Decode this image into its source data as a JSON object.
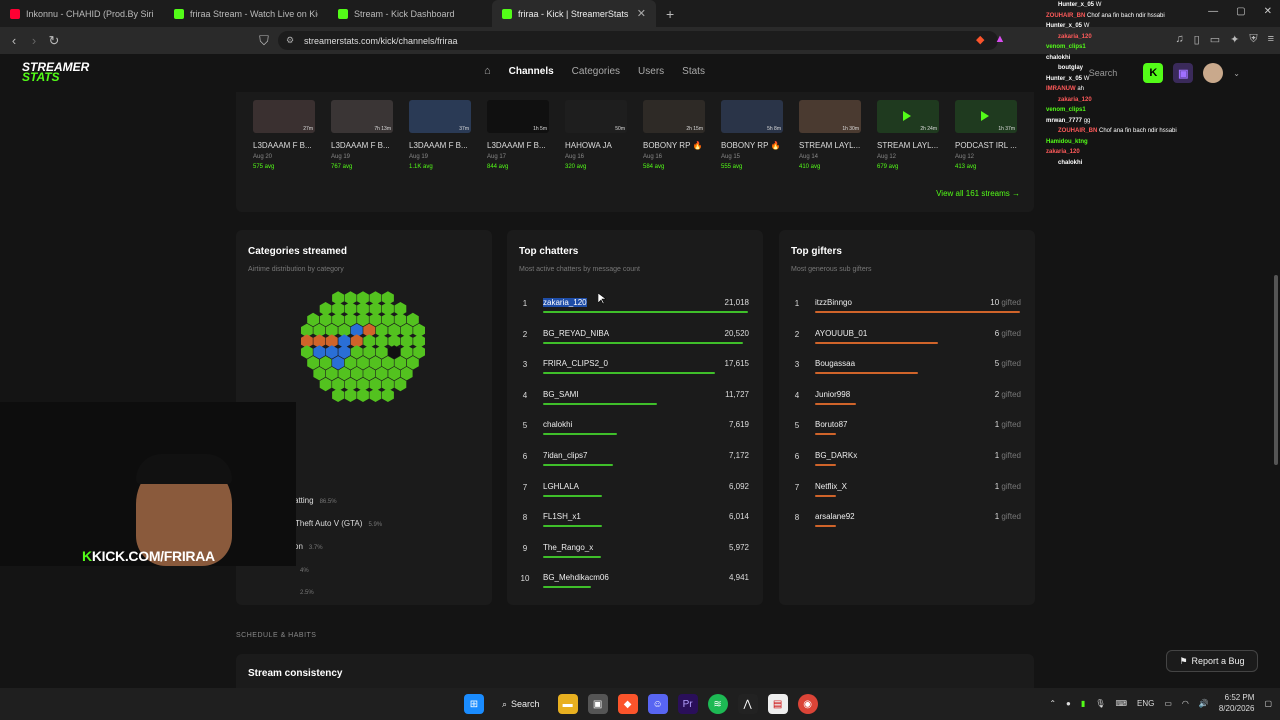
{
  "tabs": [
    {
      "title": "Inkonnu - CHAHID (Prod.By Siriu...",
      "color": "#ff0033",
      "active": false
    },
    {
      "title": "friraa Stream - Watch Live on Kick",
      "color": "#53fc18",
      "active": false
    },
    {
      "title": "Stream - Kick Dashboard",
      "color": "#53fc18",
      "active": false
    },
    {
      "title": "friraa - Kick | StreamerStats",
      "color": "#53fc18",
      "active": true
    }
  ],
  "url": "streamerstats.com/kick/channels/friraa",
  "logo": {
    "line1": "STREAMER",
    "line2": "STATS"
  },
  "nav": [
    "Channels",
    "Categories",
    "Users",
    "Stats"
  ],
  "search_label": "Search",
  "streams": [
    {
      "title": "L3DAAAM F B...",
      "date": "Aug 20",
      "avg": "575 avg",
      "dur": "27m",
      "play": false
    },
    {
      "title": "L3DAAAM F B...",
      "date": "Aug 19",
      "avg": "767 avg",
      "dur": "7h 13m",
      "play": false
    },
    {
      "title": "L3DAAAM F B...",
      "date": "Aug 19",
      "avg": "1.1K avg",
      "dur": "37m",
      "play": false
    },
    {
      "title": "L3DAAAM F B...",
      "date": "Aug 17",
      "avg": "844 avg",
      "dur": "1h 5m",
      "play": false
    },
    {
      "title": "HAHOWA JA",
      "date": "Aug 16",
      "avg": "320 avg",
      "dur": "50m",
      "play": false
    },
    {
      "title": "BOBONY RP 🔥",
      "date": "Aug 16",
      "avg": "584 avg",
      "dur": "2h 15m",
      "play": false
    },
    {
      "title": "BOBONY RP 🔥",
      "date": "Aug 15",
      "avg": "555 avg",
      "dur": "5h 8m",
      "play": false
    },
    {
      "title": "STREAM LAYL...",
      "date": "Aug 14",
      "avg": "410 avg",
      "dur": "1h 30m",
      "play": false
    },
    {
      "title": "STREAM LAYL...",
      "date": "Aug 12",
      "avg": "679 avg",
      "dur": "2h 24m",
      "play": true
    },
    {
      "title": "PODCAST IRL ...",
      "date": "Aug 12",
      "avg": "413 avg",
      "dur": "1h 37m",
      "play": true
    }
  ],
  "view_all": "View all 161 streams →",
  "categories": {
    "title": "Categories streamed",
    "subtitle": "Airtime distribution by category",
    "legend": [
      {
        "name": "atting",
        "pct": "86.5%",
        "color": "#53c21f"
      },
      {
        "name": "Theft Auto V (GTA)",
        "pct": "5.9%",
        "color": "#2a6fd6"
      },
      {
        "name": "on",
        "pct": "3.7%",
        "color": "#d0642a"
      },
      {
        "name": "",
        "pct": "4%",
        "color": "#888888"
      },
      {
        "name": "",
        "pct": "2.5%",
        "color": "#888888"
      }
    ]
  },
  "chatters": {
    "title": "Top chatters",
    "subtitle": "Most active chatters by message count",
    "rows": [
      {
        "rank": "1",
        "name": "zakaria_120",
        "value": "21,018",
        "frac": 1.0
      },
      {
        "rank": "2",
        "name": "BG_REYAD_NIBA",
        "value": "20,520",
        "frac": 0.976
      },
      {
        "rank": "3",
        "name": "FRIRA_CLIPS2_0",
        "value": "17,615",
        "frac": 0.838
      },
      {
        "rank": "4",
        "name": "BG_SAMI",
        "value": "11,727",
        "frac": 0.558
      },
      {
        "rank": "5",
        "name": "chalokhi",
        "value": "7,619",
        "frac": 0.362
      },
      {
        "rank": "6",
        "name": "7idan_clips7",
        "value": "7,172",
        "frac": 0.341
      },
      {
        "rank": "7",
        "name": "LGHLALA",
        "value": "6,092",
        "frac": 0.29
      },
      {
        "rank": "8",
        "name": "FL1SH_x1",
        "value": "6,014",
        "frac": 0.286
      },
      {
        "rank": "9",
        "name": "The_Rango_x",
        "value": "5,972",
        "frac": 0.284
      },
      {
        "rank": "10",
        "name": "BG_Mehdikacm06",
        "value": "4,941",
        "frac": 0.235
      }
    ]
  },
  "gifters": {
    "title": "Top gifters",
    "subtitle": "Most generous sub gifters",
    "unit": "gifted",
    "rows": [
      {
        "rank": "1",
        "name": "itzzBinngo",
        "value": "10",
        "frac": 1.0
      },
      {
        "rank": "2",
        "name": "AYOUUUB_01",
        "value": "6",
        "frac": 0.6
      },
      {
        "rank": "3",
        "name": "Bougassaa",
        "value": "5",
        "frac": 0.5
      },
      {
        "rank": "4",
        "name": "Junior998",
        "value": "2",
        "frac": 0.2
      },
      {
        "rank": "5",
        "name": "Boruto87",
        "value": "1",
        "frac": 0.1
      },
      {
        "rank": "6",
        "name": "BG_DARKx",
        "value": "1",
        "frac": 0.1
      },
      {
        "rank": "7",
        "name": "Netflix_X",
        "value": "1",
        "frac": 0.1
      },
      {
        "rank": "8",
        "name": "arsalane92",
        "value": "1",
        "frac": 0.1
      }
    ]
  },
  "webcam_text": {
    "k": "K",
    "rest": "KICK.COM/FRIRAA"
  },
  "chat_overlay": [
    {
      "user": "Hunter_x_05",
      "msg": "W",
      "color": "#ffffff"
    },
    {
      "user": "ZOUHAIR_BN",
      "msg": "Chof ana fin bach ndir hssabi",
      "color": "#ff5a5a"
    },
    {
      "user": "Hunter_x_05",
      "msg": "W",
      "color": "#ffffff"
    },
    {
      "user": "zakaria_120",
      "msg": "",
      "color": "#ff5a5a"
    },
    {
      "user": "venom_clips1",
      "msg": "",
      "color": "#53fc18"
    },
    {
      "user": "chalokhi",
      "msg": "",
      "color": "#ffffff"
    },
    {
      "user": "boutglay",
      "msg": "",
      "color": "#ffffff"
    },
    {
      "user": "Hunter_x_05",
      "msg": "W",
      "color": "#ffffff"
    },
    {
      "user": "IMRANUW",
      "msg": "ah",
      "color": "#ff5a5a"
    },
    {
      "user": "zakaria_120",
      "msg": "",
      "color": "#ff5a5a"
    },
    {
      "user": "venom_clips1",
      "msg": "",
      "color": "#53fc18"
    },
    {
      "user": "mrwan_7777",
      "msg": "gg",
      "color": "#ffffff"
    },
    {
      "user": "ZOUHAIR_BN",
      "msg": "Chof ana fin bach ndir hssabi",
      "color": "#ff5a5a"
    },
    {
      "user": "Hamidou_ktng",
      "msg": "",
      "color": "#53fc18"
    },
    {
      "user": "zakaria_120",
      "msg": "",
      "color": "#ff5a5a"
    },
    {
      "user": "chalokhi",
      "msg": "",
      "color": "#ffffff"
    }
  ],
  "schedule_label": "SCHEDULE & HABITS",
  "consistency_title": "Stream consistency",
  "report_bug": "Report a Bug",
  "taskbar": {
    "search": "Search",
    "lang": "ENG",
    "time": "6:52 PM",
    "date": "8/20/2026"
  }
}
